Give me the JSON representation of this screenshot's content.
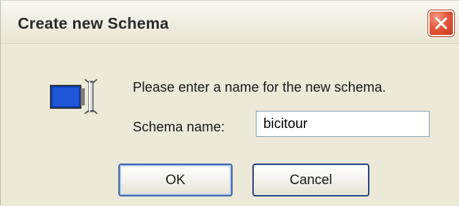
{
  "dialog": {
    "title": "Create new Schema",
    "message": "Please enter a name for the new schema.",
    "field_label": "Schema name:",
    "schema_name_value": "bicitour",
    "buttons": {
      "ok_label": "OK",
      "cancel_label": "Cancel"
    },
    "icons": {
      "close": "close-icon",
      "schema": "schema-rename-icon"
    },
    "colors": {
      "window_background": "#ece9d8",
      "close_button": "#e3593a",
      "default_button_border": "#3b5fa4",
      "icon_blue": "#0a3fbf"
    }
  }
}
